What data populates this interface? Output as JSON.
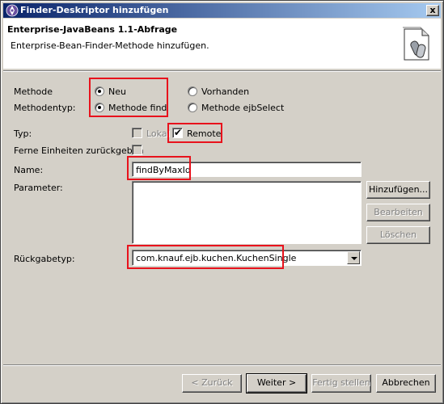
{
  "window": {
    "title": "Finder-Deskriptor hinzufügen",
    "close_label": "x"
  },
  "header": {
    "title": "Enterprise-JavaBeans 1.1-Abfrage",
    "description": "Enterprise-Bean-Finder-Methode hinzufügen."
  },
  "form": {
    "methode_label": "Methode",
    "methode_neu": "Neu",
    "methode_vorhanden": "Vorhanden",
    "methodentyp_label": "Methodentyp:",
    "methodentyp_find": "Methode find",
    "methodentyp_ejbselect": "Methode ejbSelect",
    "typ_label": "Typ:",
    "typ_lokal": "Lokal",
    "typ_remote": "Remote",
    "ferne_label": "Ferne Einheiten zurückgeben",
    "name_label": "Name:",
    "name_value": "findByMaxId",
    "parameter_label": "Parameter:",
    "rueckgabetyp_label": "Rückgabetyp:",
    "rueckgabetyp_value": "com.knauf.ejb.kuchen.KuchenSingle",
    "check_mark": "✔"
  },
  "param_buttons": {
    "add": "Hinzufügen...",
    "edit": "Bearbeiten",
    "delete": "Löschen"
  },
  "footer": {
    "back": "< Zurück",
    "next": "Weiter >",
    "finish": "Fertig stellen",
    "cancel": "Abbrechen"
  },
  "colors": {
    "highlight": "#e8121c",
    "title_start": "#0a246a",
    "title_end": "#a6caf0"
  }
}
